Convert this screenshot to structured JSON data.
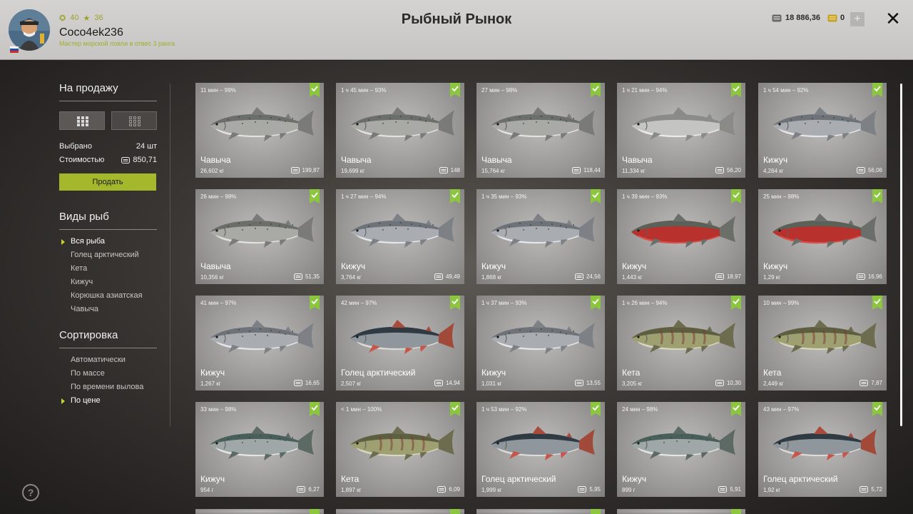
{
  "header": {
    "title": "Рыбный Рынок",
    "username": "Coco4ek236",
    "rank": "Мастер морской ловли в отвес 3 ранга",
    "level": "40",
    "stars": "36",
    "money": "18 886,36",
    "gold": "0",
    "plus": "+",
    "close": "✕"
  },
  "sidebar": {
    "sale_title": "На продажу",
    "selected_label": "Выбрано",
    "selected_value": "24 шт",
    "cost_label": "Стоимостью",
    "cost_value": "850,71",
    "sell_button": "Продать",
    "species_title": "Виды рыб",
    "species": [
      "Вся рыба",
      "Голец арктический",
      "Кета",
      "Кижуч",
      "Корюшка азиатская",
      "Чавыча"
    ],
    "sort_title": "Сортировка",
    "sort": [
      "Автоматически",
      "По массе",
      "По времени вылова",
      "По цене"
    ],
    "help": "?"
  },
  "colors": {
    "accent": "#a4b82c",
    "check": "#8cc63f"
  },
  "cards": [
    {
      "time": "11 мин – 99%",
      "name": "Чавыча",
      "weight": "26,602 кг",
      "price": "199,87",
      "kind": "chinook"
    },
    {
      "time": "1 ч 45 мин – 93%",
      "name": "Чавыча",
      "weight": "19,699 кг",
      "price": "148",
      "kind": "chinook"
    },
    {
      "time": "27 мин – 98%",
      "name": "Чавыча",
      "weight": "15,764 кг",
      "price": "118,44",
      "kind": "chinook"
    },
    {
      "time": "1 ч 21 мин – 94%",
      "name": "Чавыча",
      "weight": "11,334 кг",
      "price": "56,20",
      "kind": "chinook-light"
    },
    {
      "time": "1 ч 54 мин – 92%",
      "name": "Кижуч",
      "weight": "4,264 кг",
      "price": "56,06",
      "kind": "coho"
    },
    {
      "time": "26 мин – 98%",
      "name": "Чавыча",
      "weight": "10,356 кг",
      "price": "51,35",
      "kind": "chinook"
    },
    {
      "time": "1 ч 27 мин – 94%",
      "name": "Кижуч",
      "weight": "3,764 кг",
      "price": "49,49",
      "kind": "coho"
    },
    {
      "time": "1 ч 35 мин – 93%",
      "name": "Кижуч",
      "weight": "1,868 кг",
      "price": "24,56",
      "kind": "coho"
    },
    {
      "time": "1 ч 39 мин – 93%",
      "name": "Кижуч",
      "weight": "1,443 кг",
      "price": "18,97",
      "kind": "coho-red"
    },
    {
      "time": "25 мин – 98%",
      "name": "Кижуч",
      "weight": "1,29 кг",
      "price": "16,96",
      "kind": "coho-red"
    },
    {
      "time": "41 мин – 97%",
      "name": "Кижуч",
      "weight": "1,267 кг",
      "price": "16,65",
      "kind": "coho"
    },
    {
      "time": "42 мин – 97%",
      "name": "Голец арктический",
      "weight": "2,507 кг",
      "price": "14,94",
      "kind": "char"
    },
    {
      "time": "1 ч 37 мин – 93%",
      "name": "Кижуч",
      "weight": "1,031 кг",
      "price": "13,55",
      "kind": "coho"
    },
    {
      "time": "1 ч 26 мин – 94%",
      "name": "Кета",
      "weight": "3,205 кг",
      "price": "10,30",
      "kind": "chum"
    },
    {
      "time": "10 мин – 99%",
      "name": "Кета",
      "weight": "2,449 кг",
      "price": "7,87",
      "kind": "chum"
    },
    {
      "time": "33 мин – 98%",
      "name": "Кижуч",
      "weight": "954 г",
      "price": "6,27",
      "kind": "coho-green"
    },
    {
      "time": "< 1 мин – 100%",
      "name": "Кета",
      "weight": "1,897 кг",
      "price": "6,09",
      "kind": "chum"
    },
    {
      "time": "1 ч 53 мин – 92%",
      "name": "Голец арктический",
      "weight": "1,999 кг",
      "price": "5,95",
      "kind": "char"
    },
    {
      "time": "24 мин – 98%",
      "name": "Кижуч",
      "weight": "899 г",
      "price": "5,91",
      "kind": "coho-green"
    },
    {
      "time": "43 мин – 97%",
      "name": "Голец арктический",
      "weight": "1,92 кг",
      "price": "5,72",
      "kind": "char"
    }
  ]
}
